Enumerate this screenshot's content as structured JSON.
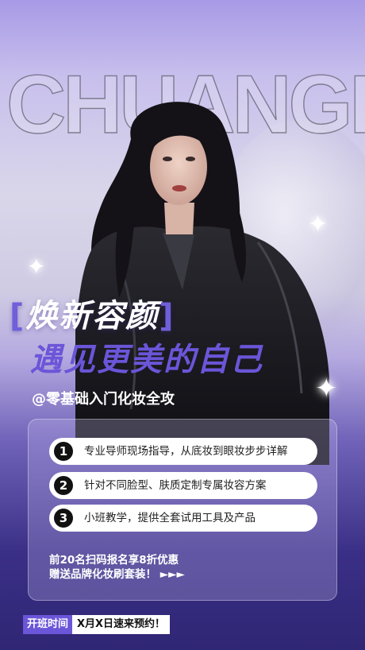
{
  "brand": "CHUANGKE",
  "title_line1": "焕新容颜",
  "title_line2": "遇见更美的自己",
  "subtitle": "@零基础入门化妆全攻",
  "features": [
    {
      "num": "1",
      "text": "专业导师现场指导，从底妆到眼妆步步详解"
    },
    {
      "num": "2",
      "text": "针对不同脸型、肤质定制专属妆容方案"
    },
    {
      "num": "3",
      "text": "小班教学，提供全套试用工具及产品"
    }
  ],
  "offer_line1": "前20名扫码报名享8折优惠",
  "offer_line2": "赠送品牌化妆刷套装！ ►►►",
  "bottom_label": "开班时间",
  "bottom_value": "X月X日速来预约！",
  "colors": {
    "accent": "#6b55d8",
    "bg_top": "#a89ae6",
    "bg_bottom": "#2f2674"
  },
  "icons": [
    "sparkle-icon"
  ]
}
